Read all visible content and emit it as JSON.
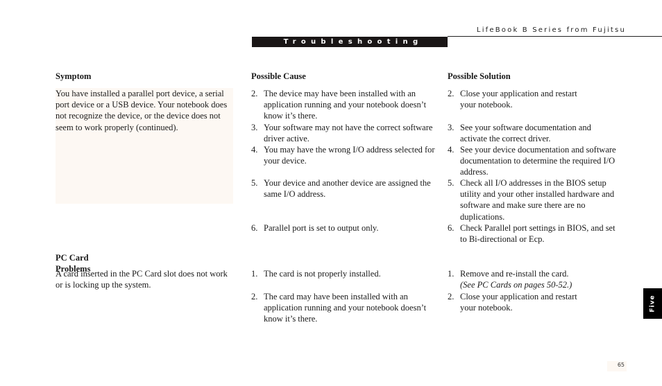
{
  "header": {
    "running_head": "LifeBook B Series from Fujitsu",
    "section_title": "Troubleshooting"
  },
  "columns": {
    "symptom": "Symptom",
    "cause": "Possible Cause",
    "solution": "Possible Solution"
  },
  "problems": [
    {
      "symptom": "You have installed a parallel port device, a serial port device or a USB device. Your notebook does not recognize the device, or the device does not seem to work properly (continued).",
      "causes": [
        {
          "num": "2.",
          "text": "The device may have been installed with an application running and your notebook doesn’t know it’s there."
        },
        {
          "num": "3.",
          "text": "Your software may not have the correct software driver active."
        },
        {
          "num": "4.",
          "text": "You may have the wrong I/O address selected for your device."
        },
        {
          "num": "5.",
          "text": "Your device and another device are assigned the same I/O address."
        },
        {
          "num": "6.",
          "text": "Parallel port is set to output only."
        }
      ],
      "solutions": [
        {
          "num": "2.",
          "text": "Close your application and restart your notebook."
        },
        {
          "num": "3.",
          "text": "See your software documentation and activate the correct driver."
        },
        {
          "num": "4.",
          "text": "See your device documentation and software documentation to determine the required I/O address."
        },
        {
          "num": "5.",
          "text": "Check all I/O addresses in the BIOS setup utility and your other installed hardware and software and make sure there are no duplications."
        },
        {
          "num": "6.",
          "text": "Check Parallel port settings in BIOS, and set to Bi-directional or Ecp."
        }
      ]
    },
    {
      "heading": "PC Card Problems",
      "symptom": "A card inserted in the PC Card slot does not work or is locking up the system.",
      "causes": [
        {
          "num": "1.",
          "text": "The card is not properly installed."
        },
        {
          "num": "2.",
          "text": "The card may have been installed with an application running and your notebook doesn’t know it’s there."
        }
      ],
      "solutions": [
        {
          "num": "1.",
          "text": "Remove and re-install the card.",
          "note": "(See PC Cards on pages 50-52.)"
        },
        {
          "num": "2.",
          "text": "Close your application and restart your notebook."
        }
      ]
    }
  ],
  "chapter_tab": "Five",
  "page_number": "65"
}
